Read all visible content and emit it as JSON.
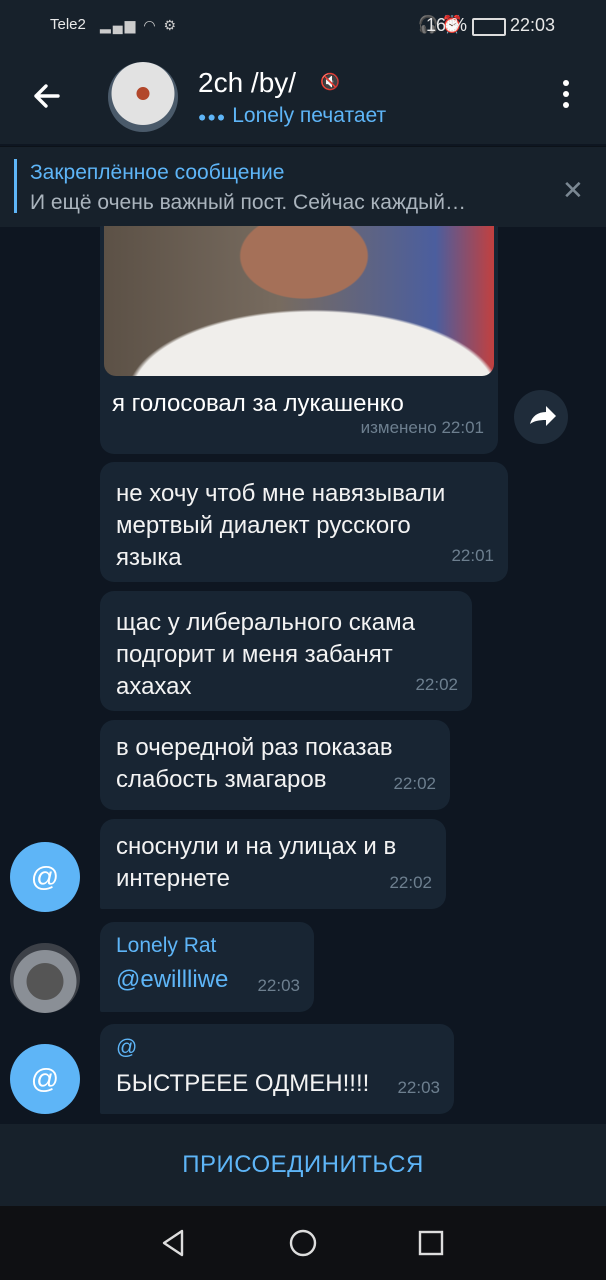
{
  "status_bar": {
    "carrier": "Tele2",
    "battery": "16 %",
    "time": "22:03"
  },
  "header": {
    "title": "2ch /by/",
    "status": "Lonely печатает",
    "muted": true
  },
  "pinned": {
    "title": "Закреплённое сообщение",
    "text": "И ещё очень важный пост.  Сейчас каждый…"
  },
  "messages": [
    {
      "caption": "я голосовал за лукашенко",
      "time": "изменено 22:01"
    },
    {
      "text_lines": [
        "не хочу чтоб мне навязывали",
        "мертвый диалект русского",
        "языка"
      ],
      "time": "22:01"
    },
    {
      "text_lines": [
        "щас у либерального скама",
        "подгорит и меня забанят",
        "ахахах"
      ],
      "time": "22:02"
    },
    {
      "text_lines": [
        "в очередной раз показав",
        "слабость змагаров"
      ],
      "time": "22:02"
    },
    {
      "text_lines": [
        "сноснули и на улицах и в",
        "интернете"
      ],
      "time": "22:02"
    },
    {
      "sender": "Lonely Rat",
      "text": "@ewillliwe",
      "time": "22:03"
    },
    {
      "sender": "@",
      "text": "БЫСТРЕЕЕ ОДМЕН!!!!",
      "time": "22:03"
    }
  ],
  "avatars": {
    "at_label": "@"
  },
  "join_button": "ПРИСОЕДИНИТЬСЯ",
  "colors": {
    "accent": "#5eb5f7",
    "background": "#0e1621",
    "bubble": "#182533"
  }
}
